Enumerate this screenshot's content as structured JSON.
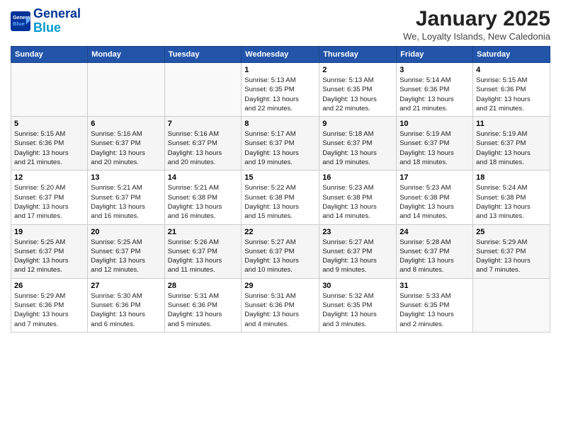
{
  "header": {
    "logo_line1": "General",
    "logo_line2": "Blue",
    "title": "January 2025",
    "subtitle": "We, Loyalty Islands, New Caledonia"
  },
  "weekdays": [
    "Sunday",
    "Monday",
    "Tuesday",
    "Wednesday",
    "Thursday",
    "Friday",
    "Saturday"
  ],
  "weeks": [
    [
      {
        "day": "",
        "info": ""
      },
      {
        "day": "",
        "info": ""
      },
      {
        "day": "",
        "info": ""
      },
      {
        "day": "1",
        "info": "Sunrise: 5:13 AM\nSunset: 6:35 PM\nDaylight: 13 hours\nand 22 minutes."
      },
      {
        "day": "2",
        "info": "Sunrise: 5:13 AM\nSunset: 6:35 PM\nDaylight: 13 hours\nand 22 minutes."
      },
      {
        "day": "3",
        "info": "Sunrise: 5:14 AM\nSunset: 6:36 PM\nDaylight: 13 hours\nand 21 minutes."
      },
      {
        "day": "4",
        "info": "Sunrise: 5:15 AM\nSunset: 6:36 PM\nDaylight: 13 hours\nand 21 minutes."
      }
    ],
    [
      {
        "day": "5",
        "info": "Sunrise: 5:15 AM\nSunset: 6:36 PM\nDaylight: 13 hours\nand 21 minutes."
      },
      {
        "day": "6",
        "info": "Sunrise: 5:16 AM\nSunset: 6:37 PM\nDaylight: 13 hours\nand 20 minutes."
      },
      {
        "day": "7",
        "info": "Sunrise: 5:16 AM\nSunset: 6:37 PM\nDaylight: 13 hours\nand 20 minutes."
      },
      {
        "day": "8",
        "info": "Sunrise: 5:17 AM\nSunset: 6:37 PM\nDaylight: 13 hours\nand 19 minutes."
      },
      {
        "day": "9",
        "info": "Sunrise: 5:18 AM\nSunset: 6:37 PM\nDaylight: 13 hours\nand 19 minutes."
      },
      {
        "day": "10",
        "info": "Sunrise: 5:19 AM\nSunset: 6:37 PM\nDaylight: 13 hours\nand 18 minutes."
      },
      {
        "day": "11",
        "info": "Sunrise: 5:19 AM\nSunset: 6:37 PM\nDaylight: 13 hours\nand 18 minutes."
      }
    ],
    [
      {
        "day": "12",
        "info": "Sunrise: 5:20 AM\nSunset: 6:37 PM\nDaylight: 13 hours\nand 17 minutes."
      },
      {
        "day": "13",
        "info": "Sunrise: 5:21 AM\nSunset: 6:37 PM\nDaylight: 13 hours\nand 16 minutes."
      },
      {
        "day": "14",
        "info": "Sunrise: 5:21 AM\nSunset: 6:38 PM\nDaylight: 13 hours\nand 16 minutes."
      },
      {
        "day": "15",
        "info": "Sunrise: 5:22 AM\nSunset: 6:38 PM\nDaylight: 13 hours\nand 15 minutes."
      },
      {
        "day": "16",
        "info": "Sunrise: 5:23 AM\nSunset: 6:38 PM\nDaylight: 13 hours\nand 14 minutes."
      },
      {
        "day": "17",
        "info": "Sunrise: 5:23 AM\nSunset: 6:38 PM\nDaylight: 13 hours\nand 14 minutes."
      },
      {
        "day": "18",
        "info": "Sunrise: 5:24 AM\nSunset: 6:38 PM\nDaylight: 13 hours\nand 13 minutes."
      }
    ],
    [
      {
        "day": "19",
        "info": "Sunrise: 5:25 AM\nSunset: 6:37 PM\nDaylight: 13 hours\nand 12 minutes."
      },
      {
        "day": "20",
        "info": "Sunrise: 5:25 AM\nSunset: 6:37 PM\nDaylight: 13 hours\nand 12 minutes."
      },
      {
        "day": "21",
        "info": "Sunrise: 5:26 AM\nSunset: 6:37 PM\nDaylight: 13 hours\nand 11 minutes."
      },
      {
        "day": "22",
        "info": "Sunrise: 5:27 AM\nSunset: 6:37 PM\nDaylight: 13 hours\nand 10 minutes."
      },
      {
        "day": "23",
        "info": "Sunrise: 5:27 AM\nSunset: 6:37 PM\nDaylight: 13 hours\nand 9 minutes."
      },
      {
        "day": "24",
        "info": "Sunrise: 5:28 AM\nSunset: 6:37 PM\nDaylight: 13 hours\nand 8 minutes."
      },
      {
        "day": "25",
        "info": "Sunrise: 5:29 AM\nSunset: 6:37 PM\nDaylight: 13 hours\nand 7 minutes."
      }
    ],
    [
      {
        "day": "26",
        "info": "Sunrise: 5:29 AM\nSunset: 6:36 PM\nDaylight: 13 hours\nand 7 minutes."
      },
      {
        "day": "27",
        "info": "Sunrise: 5:30 AM\nSunset: 6:36 PM\nDaylight: 13 hours\nand 6 minutes."
      },
      {
        "day": "28",
        "info": "Sunrise: 5:31 AM\nSunset: 6:36 PM\nDaylight: 13 hours\nand 5 minutes."
      },
      {
        "day": "29",
        "info": "Sunrise: 5:31 AM\nSunset: 6:36 PM\nDaylight: 13 hours\nand 4 minutes."
      },
      {
        "day": "30",
        "info": "Sunrise: 5:32 AM\nSunset: 6:35 PM\nDaylight: 13 hours\nand 3 minutes."
      },
      {
        "day": "31",
        "info": "Sunrise: 5:33 AM\nSunset: 6:35 PM\nDaylight: 13 hours\nand 2 minutes."
      },
      {
        "day": "",
        "info": ""
      }
    ]
  ]
}
